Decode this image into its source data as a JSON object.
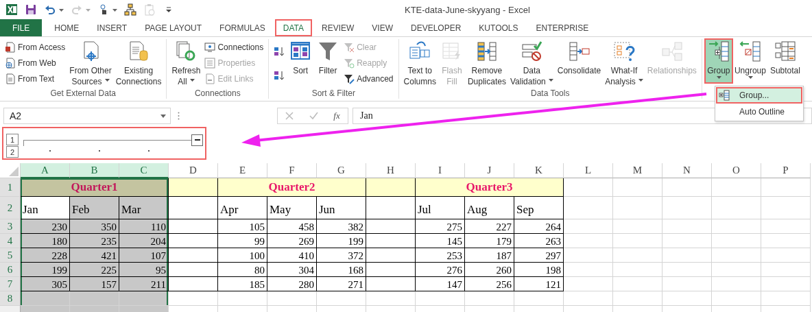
{
  "window": {
    "title": "KTE-data-June-skyyang - Excel"
  },
  "quick_access": [
    {
      "dropdown": false,
      "disabled": false
    },
    {
      "dropdown": false,
      "disabled": false
    },
    {
      "dropdown": true,
      "disabled": false
    },
    {
      "dropdown": true,
      "disabled": true
    },
    {
      "dropdown": true,
      "disabled": false
    },
    {
      "dropdown": false,
      "disabled": false
    },
    {
      "dropdown": false,
      "disabled": true
    },
    {
      "dropdown": false,
      "disabled": false
    }
  ],
  "tabs": [
    {
      "label": "FILE",
      "kind": "file",
      "selected": false
    },
    {
      "label": "HOME",
      "kind": "tab",
      "selected": false
    },
    {
      "label": "INSERT",
      "kind": "tab",
      "selected": false
    },
    {
      "label": "PAGE LAYOUT",
      "kind": "tab",
      "selected": false
    },
    {
      "label": "FORMULAS",
      "kind": "tab",
      "selected": false
    },
    {
      "label": "DATA",
      "kind": "tab",
      "selected": true
    },
    {
      "label": "REVIEW",
      "kind": "tab",
      "selected": false
    },
    {
      "label": "VIEW",
      "kind": "tab",
      "selected": false
    },
    {
      "label": "DEVELOPER",
      "kind": "tab",
      "selected": false
    },
    {
      "label": "KUTOOLS",
      "kind": "tab",
      "selected": false
    },
    {
      "label": "ENTERPRISE",
      "kind": "tab",
      "selected": false
    }
  ],
  "ribbon": {
    "groups": [
      {
        "label": "Get External Data",
        "items": [
          {
            "kind": "stack",
            "items": [
              {
                "label": "From Access",
                "disabled": false
              },
              {
                "label": "From Web",
                "disabled": false
              },
              {
                "label": "From Text",
                "disabled": false
              }
            ]
          },
          {
            "kind": "large",
            "lines": [
              "From Other",
              "Sources"
            ],
            "dropdown": true,
            "disabled": false,
            "pressed": false
          },
          {
            "kind": "large",
            "lines": [
              "Existing",
              "Connections"
            ],
            "dropdown": false,
            "disabled": false,
            "pressed": false
          }
        ]
      },
      {
        "label": "Connections",
        "items": [
          {
            "kind": "large",
            "lines": [
              "Refresh",
              "All"
            ],
            "dropdown": true,
            "disabled": false,
            "pressed": false
          },
          {
            "kind": "stack",
            "items": [
              {
                "label": "Connections",
                "disabled": false
              },
              {
                "label": "Properties",
                "disabled": true
              },
              {
                "label": "Edit Links",
                "disabled": true
              }
            ]
          }
        ]
      },
      {
        "label": "Sort & Filter",
        "items": [
          {
            "kind": "stack",
            "items": [
              {
                "disabled": false
              },
              {
                "disabled": false
              }
            ]
          },
          {
            "kind": "large",
            "lines": [
              "Sort"
            ],
            "dropdown": false,
            "disabled": false,
            "pressed": false
          },
          {
            "kind": "large",
            "lines": [
              "Filter"
            ],
            "dropdown": false,
            "disabled": false,
            "pressed": false
          },
          {
            "kind": "stack",
            "items": [
              {
                "label": "Clear",
                "disabled": true
              },
              {
                "label": "Reapply",
                "disabled": true
              },
              {
                "label": "Advanced",
                "disabled": false
              }
            ]
          }
        ]
      },
      {
        "label": "Data Tools",
        "items": [
          {
            "kind": "large",
            "lines": [
              "Text to",
              "Columns"
            ],
            "dropdown": false,
            "disabled": false,
            "pressed": false
          },
          {
            "kind": "large",
            "lines": [
              "Flash",
              "Fill"
            ],
            "dropdown": false,
            "disabled": true,
            "pressed": false
          },
          {
            "kind": "large",
            "lines": [
              "Remove",
              "Duplicates"
            ],
            "dropdown": false,
            "disabled": false,
            "pressed": false
          },
          {
            "kind": "large",
            "lines": [
              "Data",
              "Validation"
            ],
            "dropdown": true,
            "disabled": false,
            "pressed": false
          },
          {
            "kind": "large",
            "lines": [
              "Consolidate"
            ],
            "dropdown": false,
            "disabled": false,
            "pressed": false
          },
          {
            "kind": "large",
            "lines": [
              "What-If",
              "Analysis"
            ],
            "dropdown": true,
            "disabled": false,
            "pressed": false
          },
          {
            "kind": "large",
            "lines": [
              "Relationships"
            ],
            "dropdown": false,
            "disabled": true,
            "pressed": false
          }
        ]
      },
      {
        "items": [
          {
            "kind": "large",
            "lines": [
              "Group"
            ],
            "dropdown": true,
            "disabled": false,
            "pressed": true
          },
          {
            "kind": "large",
            "lines": [
              "Ungroup"
            ],
            "dropdown": true,
            "disabled": false,
            "pressed": false
          },
          {
            "kind": "large",
            "lines": [
              "Subtotal"
            ],
            "dropdown": false,
            "disabled": false,
            "pressed": false
          }
        ]
      }
    ]
  },
  "menu": {
    "items": [
      {
        "label": "Group...",
        "kind": "icon",
        "highlighted": true
      },
      {
        "label": "Auto Outline",
        "kind": "plain",
        "highlighted": false
      }
    ]
  },
  "formula_bar": {
    "name_box": "A2",
    "insert_function": "fx",
    "value": "Jan"
  },
  "outline": {
    "levels": [
      {
        "label": "1"
      },
      {
        "label": "2"
      }
    ],
    "expanded": true
  },
  "sheet": {
    "columns": [
      {
        "label": "A",
        "selected": true,
        "grouped": true
      },
      {
        "label": "B",
        "selected": true,
        "grouped": true
      },
      {
        "label": "C",
        "selected": true,
        "grouped": true
      },
      {
        "label": "D",
        "selected": false,
        "grouped": false
      },
      {
        "label": "E",
        "selected": false,
        "grouped": false
      },
      {
        "label": "F",
        "selected": false,
        "grouped": false
      },
      {
        "label": "G",
        "selected": false,
        "grouped": false
      },
      {
        "label": "H",
        "selected": false,
        "grouped": false
      },
      {
        "label": "I",
        "selected": false,
        "grouped": false
      },
      {
        "label": "J",
        "selected": false,
        "grouped": false
      },
      {
        "label": "K",
        "selected": false,
        "grouped": false
      },
      {
        "label": "L",
        "selected": false,
        "grouped": false
      },
      {
        "label": "M",
        "selected": false,
        "grouped": false
      },
      {
        "label": "N",
        "selected": false,
        "grouped": false
      },
      {
        "label": "O",
        "selected": false,
        "grouped": false
      },
      {
        "label": "P",
        "selected": false,
        "grouped": false
      }
    ],
    "rows": [
      {
        "label": "1",
        "selected": true,
        "kind": "bands",
        "bands": [
          {
            "kind": "merged",
            "text": "Quarter1",
            "color": "#c4c4a0"
          },
          {
            "kind": "single",
            "color": "#ffffcc"
          },
          {
            "kind": "merged",
            "text": "Quarter2",
            "color": "#ffffcc"
          },
          {
            "kind": "single",
            "color": "#ffffcc"
          },
          {
            "kind": "merged",
            "text": "Quarter3",
            "color": "#ffffcc"
          }
        ]
      },
      {
        "label": "2",
        "selected": true,
        "kind": "header",
        "cells": [
          "Jan",
          "Feb",
          "Mar",
          null,
          "Apr",
          "May",
          "Jun",
          null,
          "Jul",
          "Aug",
          "Sep"
        ],
        "shaded": [
          false,
          true,
          true
        ]
      },
      {
        "label": "3",
        "selected": true,
        "kind": "numbers",
        "cells": [
          "230",
          "350",
          "110",
          null,
          "105",
          "458",
          "382",
          null,
          "275",
          "227",
          "264"
        ],
        "shaded": [
          true,
          true,
          true
        ]
      },
      {
        "label": "4",
        "selected": true,
        "kind": "numbers",
        "cells": [
          "180",
          "235",
          "204",
          null,
          "99",
          "269",
          "199",
          null,
          "145",
          "179",
          "263"
        ],
        "shaded": [
          true,
          true,
          true
        ]
      },
      {
        "label": "5",
        "selected": true,
        "kind": "numbers",
        "cells": [
          "228",
          "421",
          "107",
          null,
          "100",
          "410",
          "372",
          null,
          "253",
          "187",
          "297"
        ],
        "shaded": [
          true,
          true,
          true
        ]
      },
      {
        "label": "6",
        "selected": true,
        "kind": "numbers",
        "cells": [
          "199",
          "225",
          "95",
          null,
          "80",
          "304",
          "168",
          null,
          "276",
          "260",
          "198"
        ],
        "shaded": [
          true,
          true,
          true
        ]
      },
      {
        "label": "7",
        "selected": true,
        "kind": "numbers",
        "cells": [
          "305",
          "157",
          "211",
          null,
          "185",
          "280",
          "271",
          null,
          "147",
          "256",
          "121"
        ],
        "shaded": [
          true,
          true,
          true
        ]
      },
      {
        "label": "8",
        "selected": true,
        "kind": "empty",
        "cells": [],
        "shaded": [
          true,
          true,
          true
        ]
      }
    ]
  }
}
